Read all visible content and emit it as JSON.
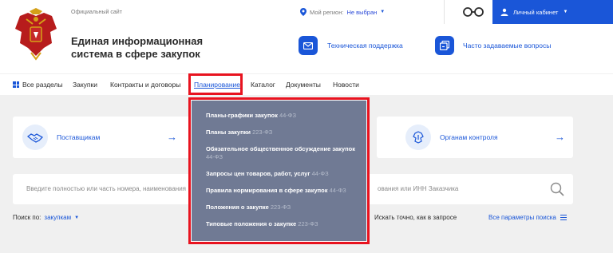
{
  "header": {
    "official_label": "Официальный сайт",
    "title": "Единая информационная система в сфере закупок",
    "region_label": "Мой регион:",
    "region_value": "Не выбран",
    "cabinet_label": "Личный кабинет"
  },
  "support": {
    "label": "Техническая поддержка"
  },
  "faq": {
    "label": "Часто задаваемые вопросы"
  },
  "nav": {
    "all_sections": "Все разделы",
    "items": [
      "Закупки",
      "Контракты и договоры",
      "Планирование",
      "Каталог",
      "Документы",
      "Новости"
    ]
  },
  "cards": {
    "suppliers": "Поставщикам",
    "control": "Органам контроля"
  },
  "search": {
    "left_text": "Введите полностью или часть номера, наименования",
    "right_text": "ования или ИНН Заказчика",
    "by_label": "Поиск по:",
    "by_value": "закупкам",
    "exact": "Искать точно, как в запросе",
    "all_params": "Все параметры поиска"
  },
  "dropdown": {
    "items": [
      {
        "label": "Планы-графики закупок",
        "law": "44-ФЗ"
      },
      {
        "label": "Планы закупки",
        "law": "223-ФЗ"
      },
      {
        "label": "Обязательное общественное обсуждение закупок",
        "law": "44-ФЗ"
      },
      {
        "label": "Запросы цен товаров, работ, услуг",
        "law": "44-ФЗ"
      },
      {
        "label": "Правила нормирования в сфере закупок",
        "law": "44-ФЗ"
      },
      {
        "label": "Положения о закупке",
        "law": "223-ФЗ"
      },
      {
        "label": "Типовые положения о закупке",
        "law": "223-ФЗ"
      }
    ]
  },
  "colors": {
    "accent": "#1a56d8",
    "highlight": "#e8131f",
    "dropdown_bg": "#707a94",
    "page_bg": "#f0f0f0"
  }
}
